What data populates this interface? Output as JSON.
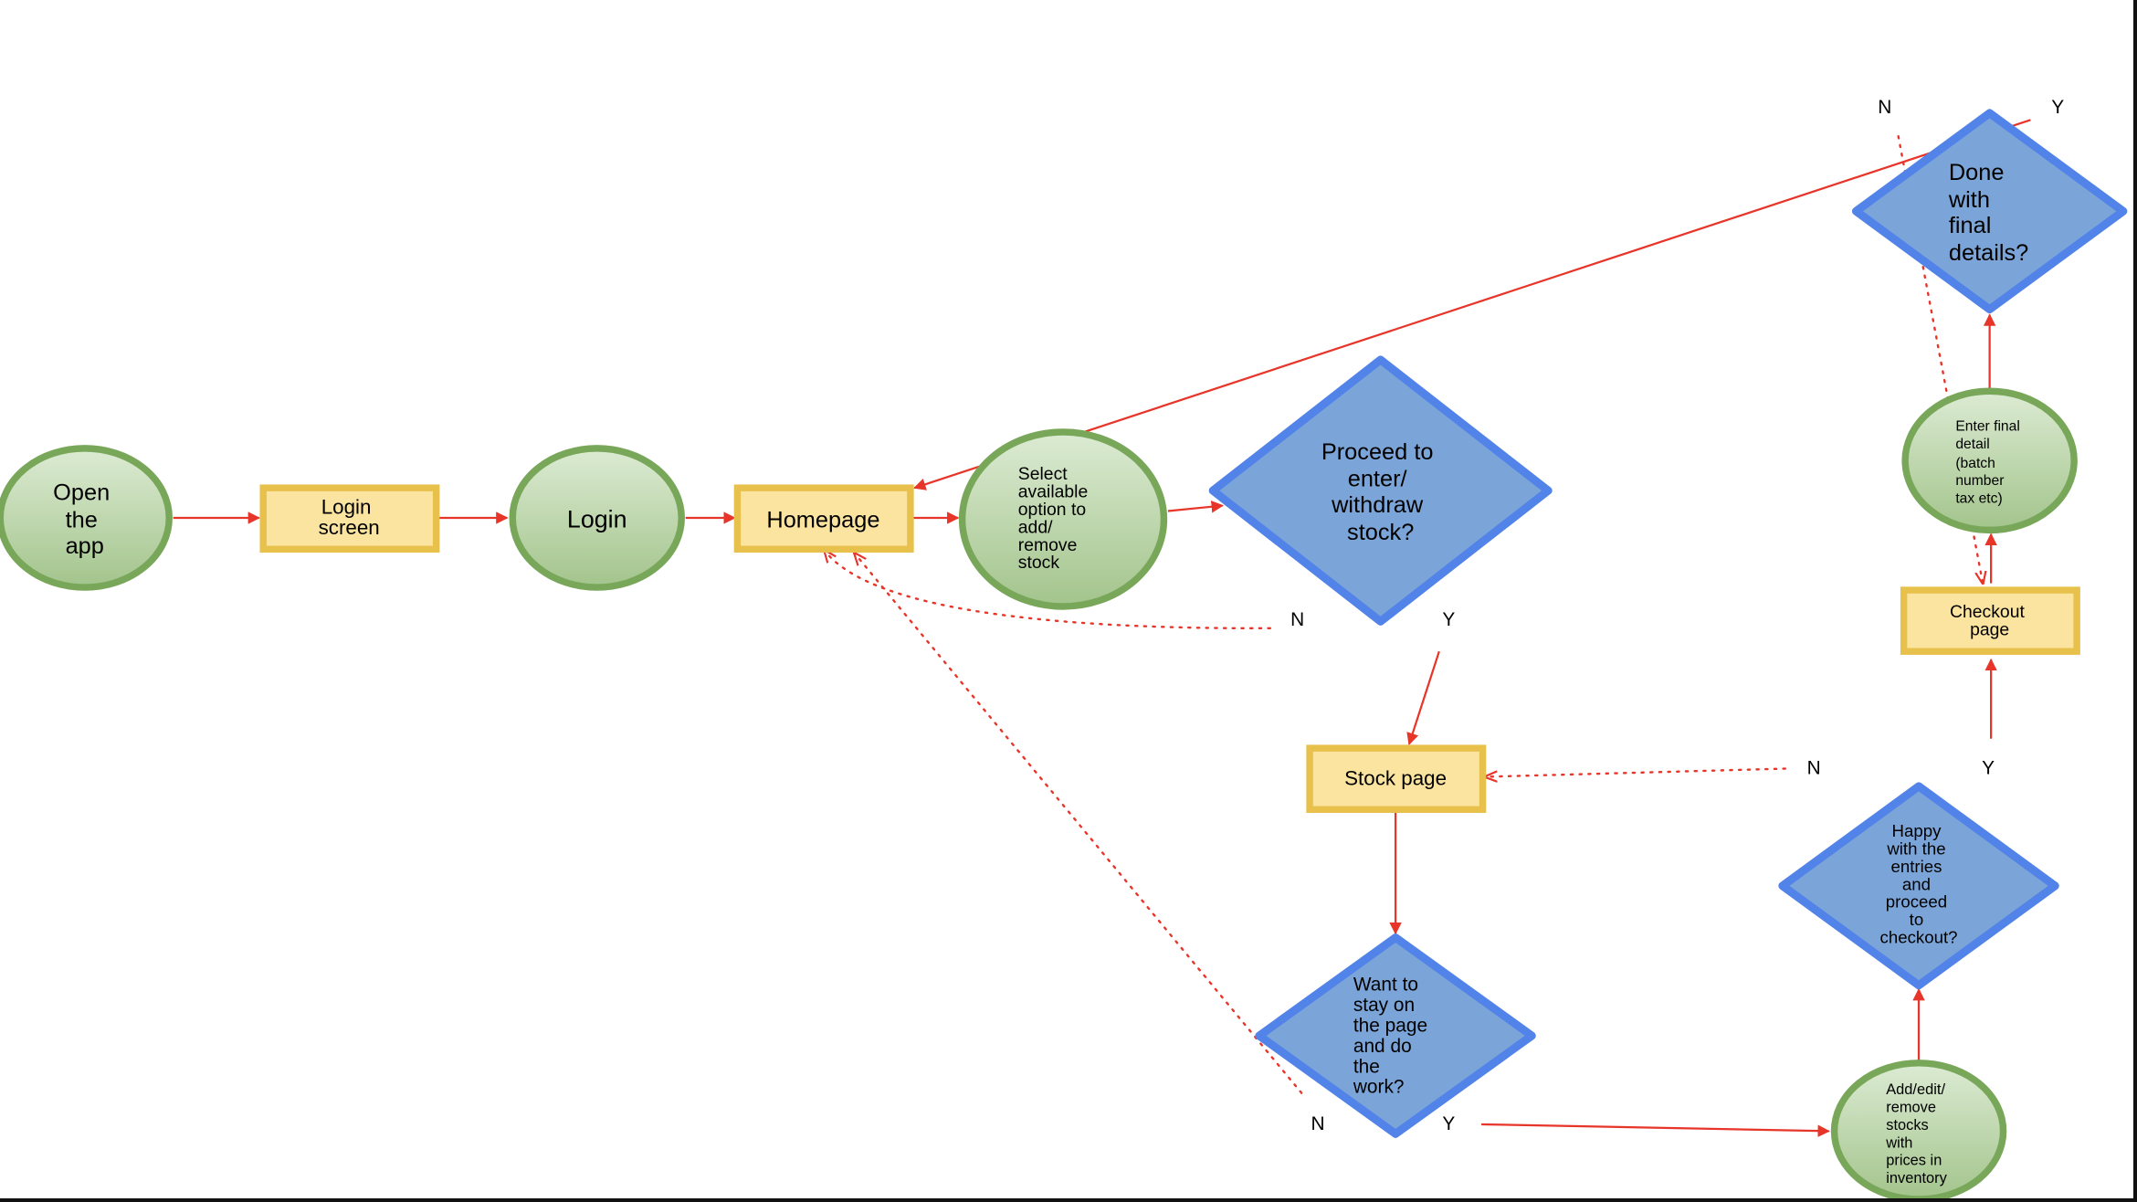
{
  "colors": {
    "arrow": "#e8352a",
    "process_fill": "#c4dbb6",
    "process_border": "#79a75a",
    "screen_fill": "#fbe4a0",
    "screen_border": "#e8c14c",
    "decision_fill": "#7ba5d8",
    "decision_border": "#5283e8"
  },
  "nodes": {
    "open_app": {
      "lines": [
        "Open",
        "the",
        "app"
      ]
    },
    "login_screen": {
      "lines": [
        "Login",
        "screen"
      ]
    },
    "login": {
      "lines": [
        "Login"
      ]
    },
    "homepage": {
      "lines": [
        "Homepage"
      ]
    },
    "select_option": {
      "lines": [
        "Select",
        "available",
        "option to",
        "add/",
        "remove",
        "stock"
      ]
    },
    "proceed": {
      "lines": [
        "Proceed to",
        "enter/",
        "withdraw",
        "stock?"
      ]
    },
    "stock_page": {
      "lines": [
        "Stock page"
      ]
    },
    "want_stay": {
      "lines": [
        "Want to",
        "stay on",
        "the page",
        "and do",
        "the",
        "work?"
      ]
    },
    "add_edit": {
      "lines": [
        "Add/edit/",
        "remove",
        "stocks",
        "with",
        "prices in",
        "inventory"
      ]
    },
    "happy": {
      "lines": [
        "Happy",
        "with the",
        "entries",
        "and",
        "proceed",
        "to",
        "checkout?"
      ]
    },
    "checkout": {
      "lines": [
        "Checkout",
        "page"
      ]
    },
    "enter_final": {
      "lines": [
        "Enter final",
        "detail",
        "(batch",
        "number",
        "tax etc)"
      ]
    },
    "done": {
      "lines": [
        "Done",
        "with",
        "final",
        "details?"
      ]
    }
  },
  "labels": {
    "proceed_n": "N",
    "proceed_y": "Y",
    "want_n": "N",
    "want_y": "Y",
    "happy_n": "N",
    "happy_y": "Y",
    "done_n": "N",
    "done_y": "Y"
  }
}
